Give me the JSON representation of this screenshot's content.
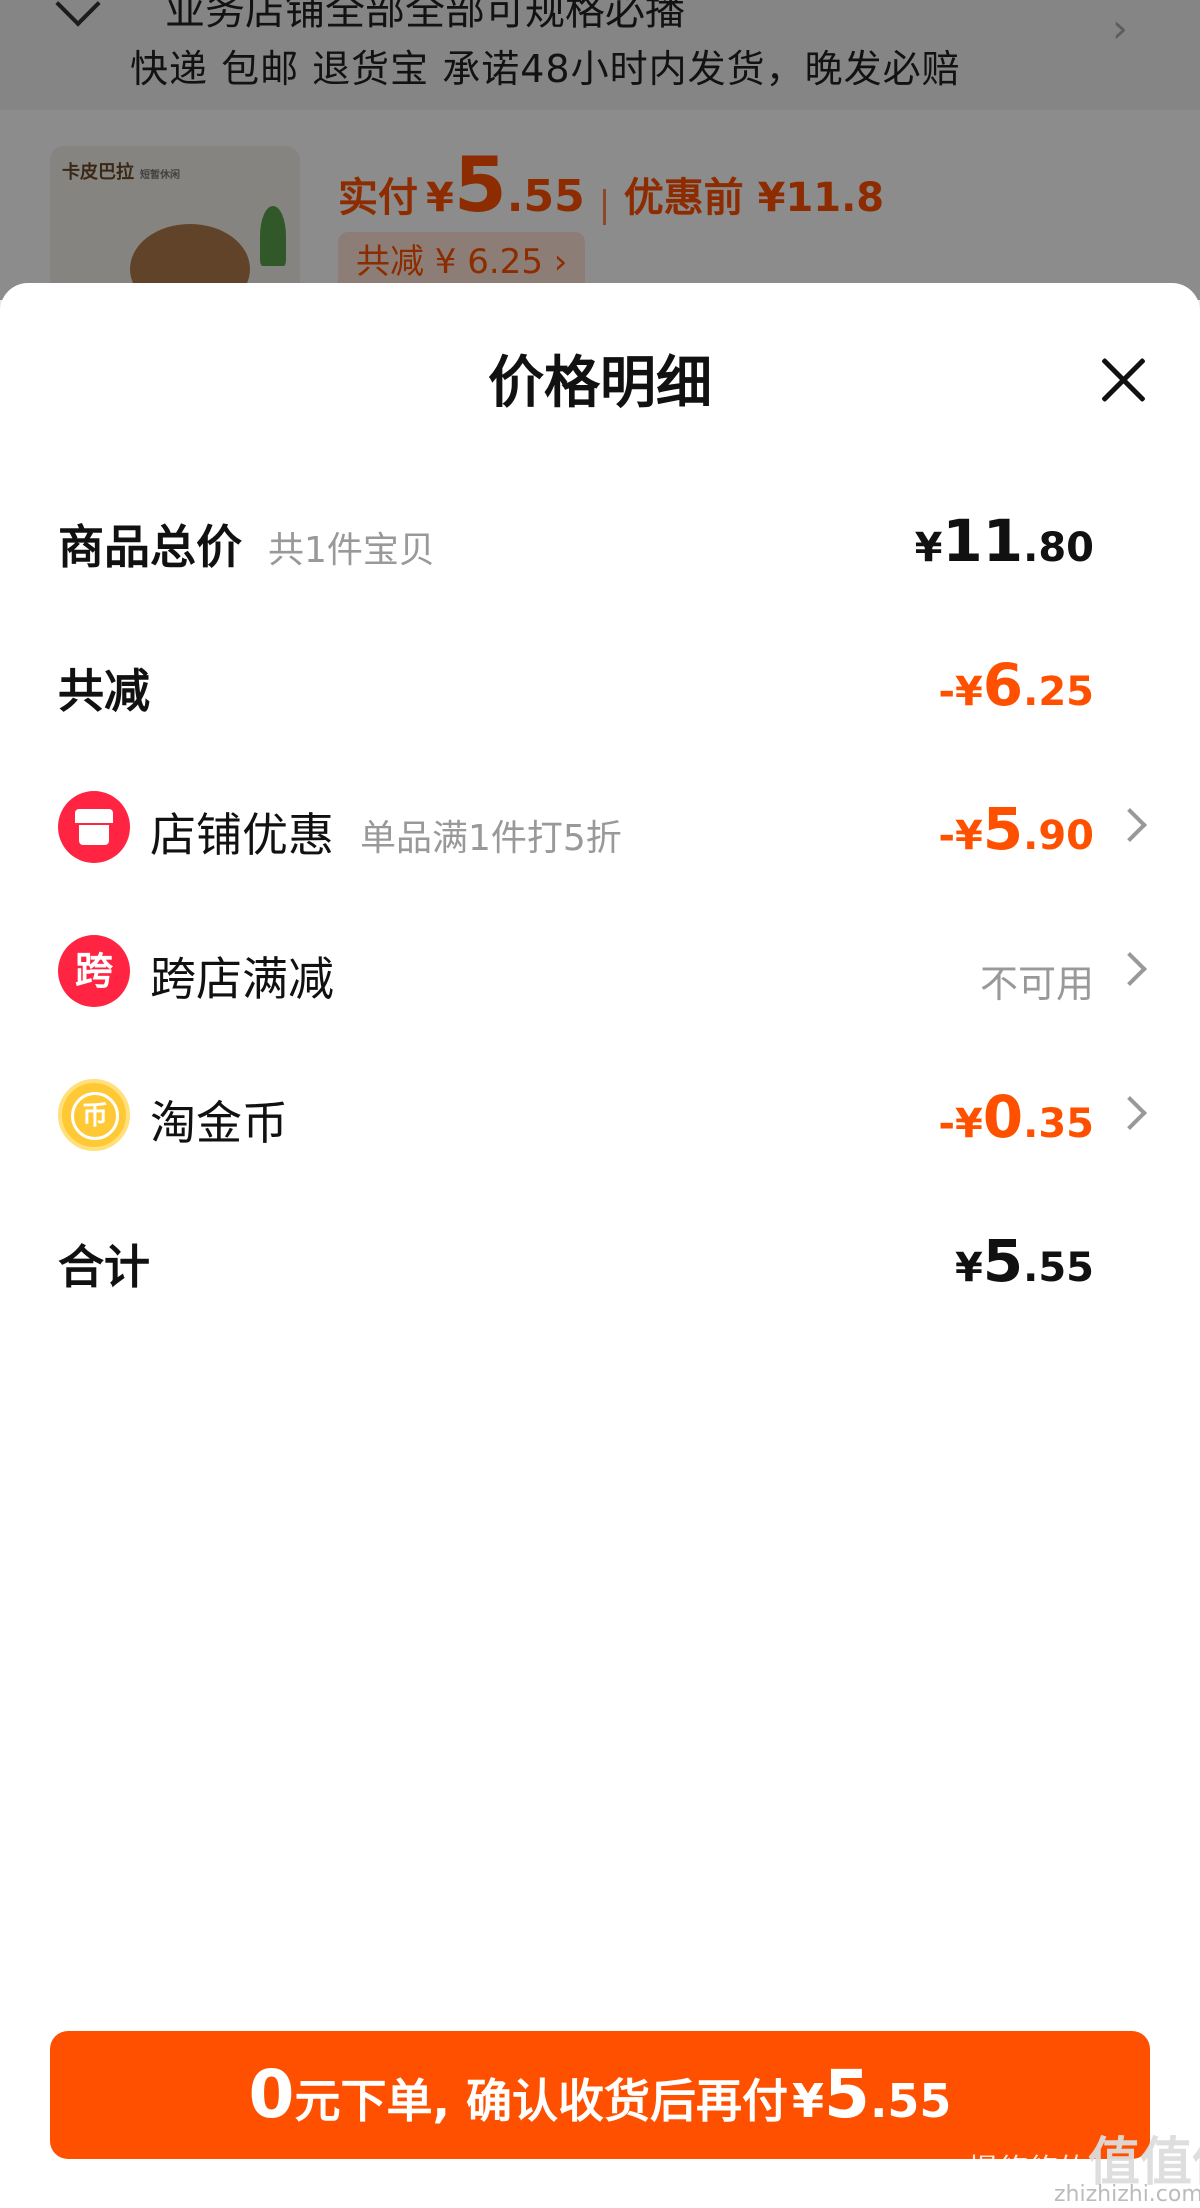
{
  "background": {
    "truncated_line": "业务店铺全部全部可规格必播",
    "shipping_info": "快递 包邮 退货宝 承诺48小时内发货，晚发必赔",
    "product_brand": "卡皮巴拉",
    "product_brand_sub": "短暂休闲",
    "paid_label": "实付",
    "paid_currency": "¥",
    "paid_int": "5",
    "paid_dec": ".55",
    "before_discount": "优惠前 ¥11.8",
    "saving_chip": "共减 ¥ 6.25 ›"
  },
  "sheet": {
    "title": "价格明细",
    "rows": [
      {
        "label": "商品总价",
        "hint": "共1件宝贝",
        "currency": "¥",
        "int": "11",
        "dec": ".80"
      },
      {
        "label": "共减",
        "currency": "-¥",
        "int": "6",
        "dec": ".25"
      },
      {
        "label": "店铺优惠",
        "hint": "单品满1件打5折",
        "currency": "-¥",
        "int": "5",
        "dec": ".90"
      },
      {
        "label": "跨店满减",
        "icon_char": "跨",
        "status": "不可用"
      },
      {
        "label": "淘金币",
        "icon_char": "币",
        "currency": "-¥",
        "int": "0",
        "dec": ".35"
      },
      {
        "label": "合计",
        "currency": "¥",
        "int": "5",
        "dec": ".55"
      }
    ]
  },
  "cta": {
    "zero": "0",
    "text": "元下单, 确认收货后再付",
    "currency": "¥",
    "int": "5",
    "dec": ".55"
  },
  "watermark": {
    "line1": "慢悠悠的",
    "line2": "值值值",
    "line3": "zhizhizhi.com"
  },
  "colors": {
    "accent": "#ff5000",
    "badge_red": "#ff2442",
    "coin_gold": "#ffc935"
  }
}
